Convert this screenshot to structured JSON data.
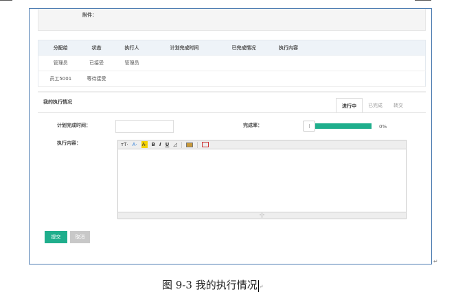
{
  "attachment": {
    "label": "附件："
  },
  "assignment_table": {
    "headers": [
      "分配给",
      "状态",
      "执行人",
      "计划完成时间",
      "已完成情况",
      "执行内容",
      ""
    ],
    "rows": [
      [
        "管理员",
        "已接受",
        "管理员",
        "",
        "",
        "",
        ""
      ],
      [
        "员工5001",
        "等待接受",
        "",
        "",
        "",
        "",
        ""
      ]
    ]
  },
  "execution": {
    "title": "我的执行情况",
    "tabs": [
      {
        "label": "进行中",
        "active": true
      },
      {
        "label": "已完成",
        "active": false
      },
      {
        "label": "转交",
        "active": false
      }
    ],
    "plan_time_label": "计划完成时间：",
    "plan_time_value": "",
    "completion_label": "完成率：",
    "completion_value": 0,
    "completion_text": "0%",
    "content_label": "执行内容：",
    "content_value": ""
  },
  "editor_toolbar": {
    "font_size": "тT·",
    "font_color": "A·",
    "highlight": "A·",
    "bold": "B",
    "italic": "I",
    "underline": "U",
    "eraser": "◿",
    "resize_handle": "-|-"
  },
  "buttons": {
    "submit": "提交",
    "cancel": "取消"
  },
  "colors": {
    "accent": "#1fae8c",
    "frame_border": "#4a7ab0",
    "highlight": "#f5d200"
  },
  "caption": {
    "text": "图 9-3  我的执行情况"
  },
  "paragraph_mark": "↵"
}
